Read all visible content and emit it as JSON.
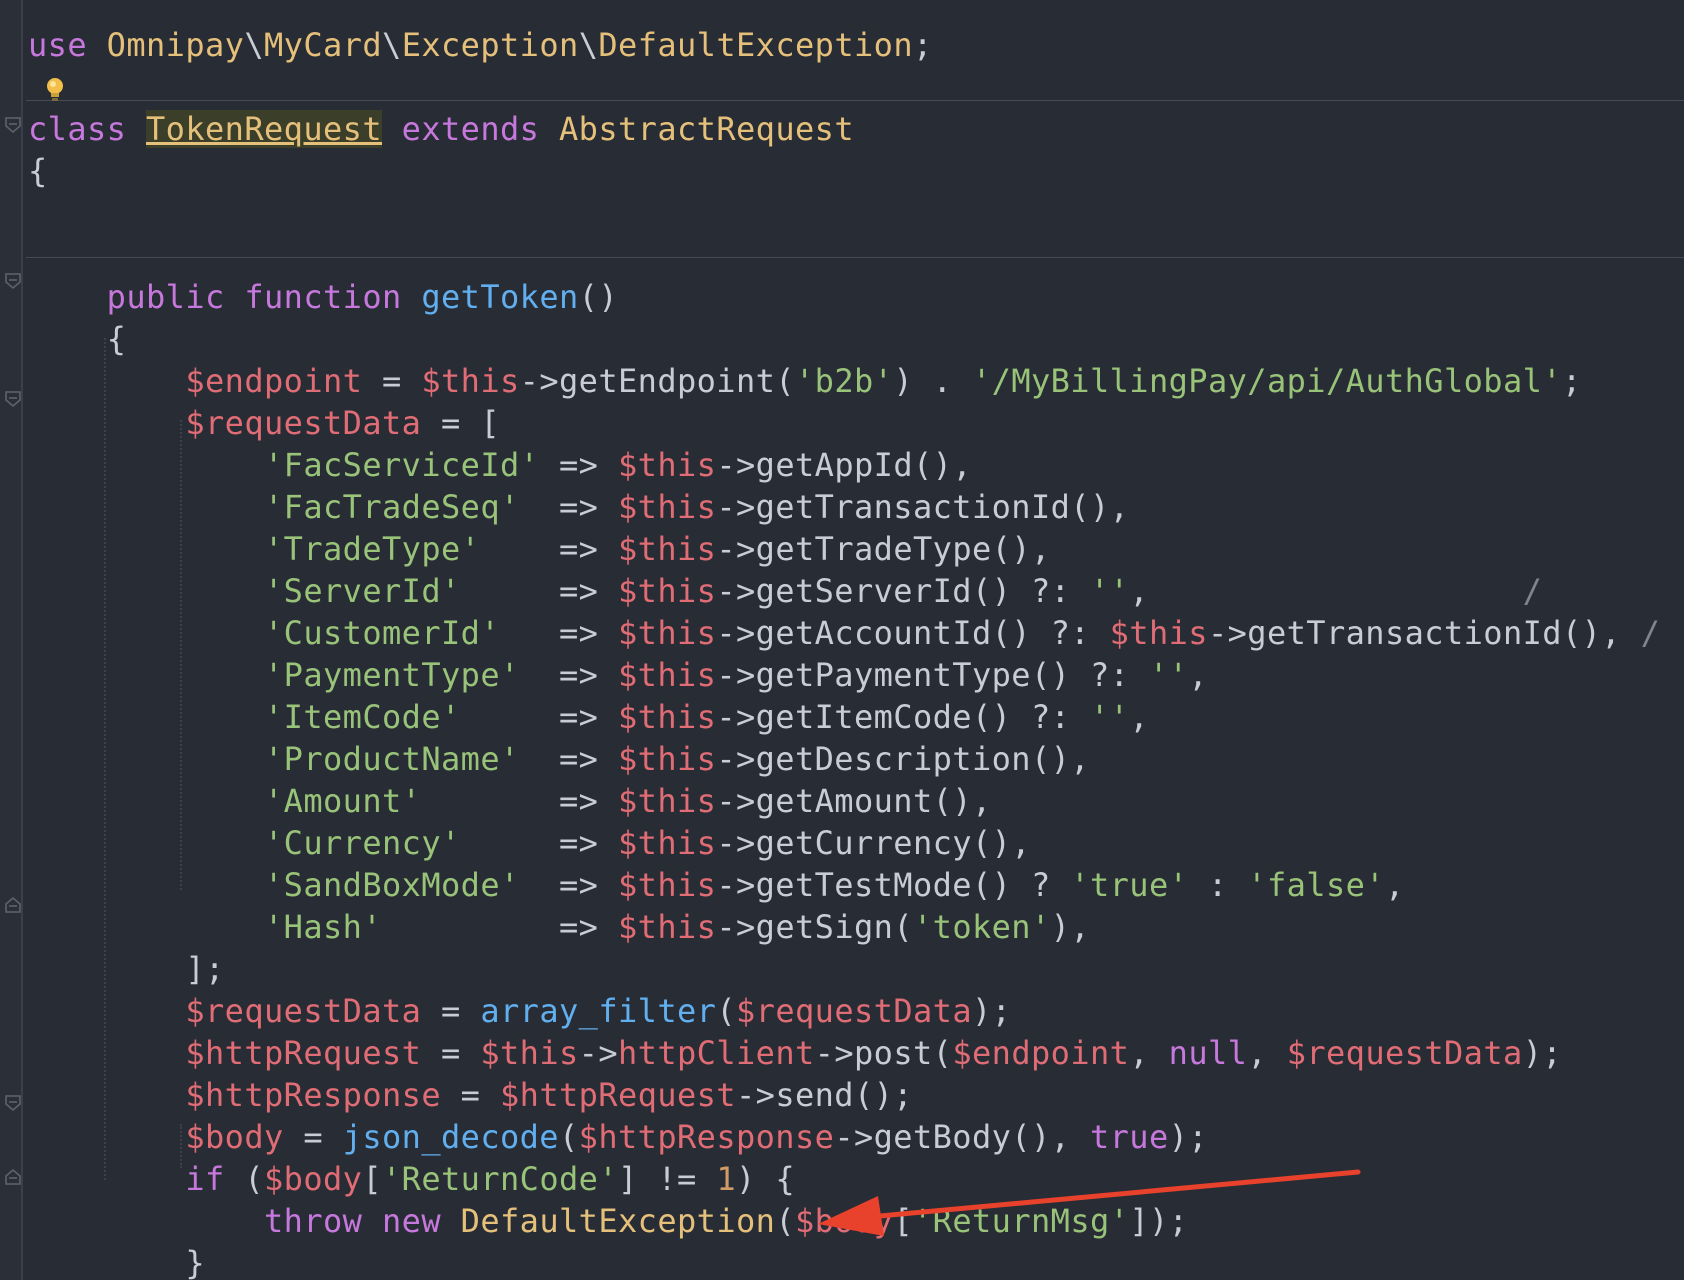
{
  "code": {
    "lines": [
      [
        [
          "kw",
          "use"
        ],
        [
          "pl",
          " "
        ],
        [
          "ty",
          "Omnipay"
        ],
        [
          "pl",
          "\\"
        ],
        [
          "ty",
          "MyCard"
        ],
        [
          "pl",
          "\\"
        ],
        [
          "ty",
          "Exception"
        ],
        [
          "pl",
          "\\"
        ],
        [
          "ty",
          "DefaultException"
        ],
        [
          "pl",
          ";"
        ]
      ],
      [],
      [
        [
          "kw",
          "class"
        ],
        [
          "pl",
          " "
        ],
        [
          "cls",
          "TokenRequest"
        ],
        [
          "pl",
          " "
        ],
        [
          "kw",
          "extends"
        ],
        [
          "pl",
          " "
        ],
        [
          "ty",
          "AbstractRequest"
        ]
      ],
      [
        [
          "pl",
          "{"
        ]
      ],
      [],
      [],
      [
        [
          "pl",
          "    "
        ],
        [
          "kw",
          "public"
        ],
        [
          "pl",
          " "
        ],
        [
          "kw",
          "function"
        ],
        [
          "pl",
          " "
        ],
        [
          "fn",
          "getToken"
        ],
        [
          "pl",
          "()"
        ]
      ],
      [
        [
          "pl",
          "    {"
        ]
      ],
      [
        [
          "pl",
          "        "
        ],
        [
          "var",
          "$endpoint"
        ],
        [
          "pl",
          " = "
        ],
        [
          "var",
          "$this"
        ],
        [
          "pl",
          "->getEndpoint("
        ],
        [
          "str",
          "'b2b'"
        ],
        [
          "pl",
          ") . "
        ],
        [
          "str",
          "'/MyBillingPay/api/AuthGlobal'"
        ],
        [
          "pl",
          ";"
        ]
      ],
      [
        [
          "pl",
          "        "
        ],
        [
          "var",
          "$requestData"
        ],
        [
          "pl",
          " = ["
        ]
      ],
      [
        [
          "pl",
          "            "
        ],
        [
          "str",
          "'FacServiceId'"
        ],
        [
          "pl",
          " => "
        ],
        [
          "var",
          "$this"
        ],
        [
          "pl",
          "->getAppId(),"
        ]
      ],
      [
        [
          "pl",
          "            "
        ],
        [
          "str",
          "'FacTradeSeq'"
        ],
        [
          "pl",
          "  => "
        ],
        [
          "var",
          "$this"
        ],
        [
          "pl",
          "->getTransactionId(),"
        ]
      ],
      [
        [
          "pl",
          "            "
        ],
        [
          "str",
          "'TradeType'"
        ],
        [
          "pl",
          "    => "
        ],
        [
          "var",
          "$this"
        ],
        [
          "pl",
          "->getTradeType(),"
        ]
      ],
      [
        [
          "pl",
          "            "
        ],
        [
          "str",
          "'ServerId'"
        ],
        [
          "pl",
          "     => "
        ],
        [
          "var",
          "$this"
        ],
        [
          "pl",
          "->getServerId() ?: "
        ],
        [
          "str",
          "''"
        ],
        [
          "pl",
          ",                   "
        ],
        [
          "cm",
          "/"
        ]
      ],
      [
        [
          "pl",
          "            "
        ],
        [
          "str",
          "'CustomerId'"
        ],
        [
          "pl",
          "   => "
        ],
        [
          "var",
          "$this"
        ],
        [
          "pl",
          "->getAccountId() ?: "
        ],
        [
          "var",
          "$this"
        ],
        [
          "pl",
          "->getTransactionId(), "
        ],
        [
          "cm",
          "/"
        ]
      ],
      [
        [
          "pl",
          "            "
        ],
        [
          "str",
          "'PaymentType'"
        ],
        [
          "pl",
          "  => "
        ],
        [
          "var",
          "$this"
        ],
        [
          "pl",
          "->getPaymentType() ?: "
        ],
        [
          "str",
          "''"
        ],
        [
          "pl",
          ","
        ]
      ],
      [
        [
          "pl",
          "            "
        ],
        [
          "str",
          "'ItemCode'"
        ],
        [
          "pl",
          "     => "
        ],
        [
          "var",
          "$this"
        ],
        [
          "pl",
          "->getItemCode() ?: "
        ],
        [
          "str",
          "''"
        ],
        [
          "pl",
          ","
        ]
      ],
      [
        [
          "pl",
          "            "
        ],
        [
          "str",
          "'ProductName'"
        ],
        [
          "pl",
          "  => "
        ],
        [
          "var",
          "$this"
        ],
        [
          "pl",
          "->getDescription(),"
        ]
      ],
      [
        [
          "pl",
          "            "
        ],
        [
          "str",
          "'Amount'"
        ],
        [
          "pl",
          "       => "
        ],
        [
          "var",
          "$this"
        ],
        [
          "pl",
          "->getAmount(),"
        ]
      ],
      [
        [
          "pl",
          "            "
        ],
        [
          "str",
          "'Currency'"
        ],
        [
          "pl",
          "     => "
        ],
        [
          "var",
          "$this"
        ],
        [
          "pl",
          "->getCurrency(),"
        ]
      ],
      [
        [
          "pl",
          "            "
        ],
        [
          "str",
          "'SandBoxMode'"
        ],
        [
          "pl",
          "  => "
        ],
        [
          "var",
          "$this"
        ],
        [
          "pl",
          "->getTestMode() ? "
        ],
        [
          "str",
          "'true'"
        ],
        [
          "pl",
          " : "
        ],
        [
          "str",
          "'false'"
        ],
        [
          "pl",
          ","
        ]
      ],
      [
        [
          "pl",
          "            "
        ],
        [
          "str",
          "'Hash'"
        ],
        [
          "pl",
          "         => "
        ],
        [
          "var",
          "$this"
        ],
        [
          "pl",
          "->getSign("
        ],
        [
          "str",
          "'token'"
        ],
        [
          "pl",
          "),"
        ]
      ],
      [
        [
          "pl",
          "        ];"
        ]
      ],
      [
        [
          "pl",
          "        "
        ],
        [
          "var",
          "$requestData"
        ],
        [
          "pl",
          " = "
        ],
        [
          "fn",
          "array_filter"
        ],
        [
          "pl",
          "("
        ],
        [
          "var",
          "$requestData"
        ],
        [
          "pl",
          ");"
        ]
      ],
      [
        [
          "pl",
          "        "
        ],
        [
          "var",
          "$httpRequest"
        ],
        [
          "pl",
          " = "
        ],
        [
          "var",
          "$this"
        ],
        [
          "pl",
          "->"
        ],
        [
          "var",
          "httpClient"
        ],
        [
          "pl",
          "->post("
        ],
        [
          "var",
          "$endpoint"
        ],
        [
          "pl",
          ", "
        ],
        [
          "kw",
          "null"
        ],
        [
          "pl",
          ", "
        ],
        [
          "var",
          "$requestData"
        ],
        [
          "pl",
          ");"
        ]
      ],
      [
        [
          "pl",
          "        "
        ],
        [
          "var",
          "$httpResponse"
        ],
        [
          "pl",
          " = "
        ],
        [
          "var",
          "$httpRequest"
        ],
        [
          "pl",
          "->send();"
        ]
      ],
      [
        [
          "pl",
          "        "
        ],
        [
          "var",
          "$body"
        ],
        [
          "pl",
          " = "
        ],
        [
          "fn",
          "json_decode"
        ],
        [
          "pl",
          "("
        ],
        [
          "var",
          "$httpResponse"
        ],
        [
          "pl",
          "->getBody(), "
        ],
        [
          "kw",
          "true"
        ],
        [
          "pl",
          ");"
        ]
      ],
      [
        [
          "pl",
          "        "
        ],
        [
          "kw",
          "if"
        ],
        [
          "pl",
          " ("
        ],
        [
          "var",
          "$body"
        ],
        [
          "pl",
          "["
        ],
        [
          "str",
          "'ReturnCode'"
        ],
        [
          "pl",
          "] != "
        ],
        [
          "num",
          "1"
        ],
        [
          "pl",
          ") {"
        ]
      ],
      [
        [
          "pl",
          "            "
        ],
        [
          "kw",
          "throw"
        ],
        [
          "pl",
          " "
        ],
        [
          "kw",
          "new"
        ],
        [
          "pl",
          " "
        ],
        [
          "ty",
          "DefaultException"
        ],
        [
          "pl",
          "("
        ],
        [
          "var",
          "$body"
        ],
        [
          "pl",
          "["
        ],
        [
          "str",
          "'ReturnMsg'"
        ],
        [
          "pl",
          "]);"
        ]
      ],
      [
        [
          "pl",
          "        }"
        ]
      ]
    ]
  },
  "annotation": {
    "arrow_color": "#e8412c",
    "icon": "lightbulb-icon"
  }
}
